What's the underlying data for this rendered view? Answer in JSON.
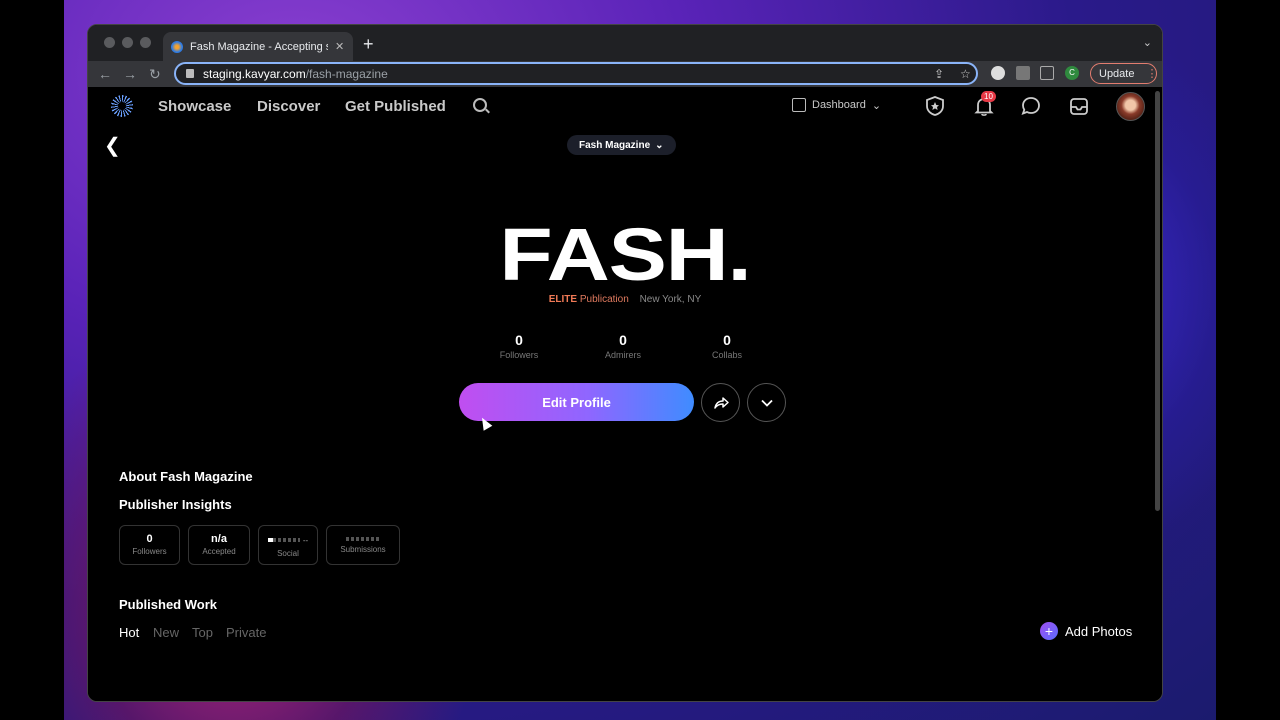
{
  "browser": {
    "tab_title": "Fash Magazine - Accepting sul",
    "tab_close": "✕",
    "new_tab": "+",
    "url_host": "staging.kavyar.com",
    "url_path": "/fash-magazine",
    "update_label": "Update",
    "ext_letter": "C"
  },
  "nav": {
    "links": [
      "Showcase",
      "Discover",
      "Get Published"
    ],
    "dashboard_label": "Dashboard",
    "notification_count": "10"
  },
  "profile": {
    "selector_label": "Fash Magazine",
    "brand": "FASH.",
    "tier": "ELITE",
    "type": "Publication",
    "location": "New York, NY",
    "stats": [
      {
        "value": "0",
        "label": "Followers"
      },
      {
        "value": "0",
        "label": "Admirers"
      },
      {
        "value": "0",
        "label": "Collabs"
      }
    ],
    "edit_label": "Edit Profile"
  },
  "about": {
    "title": "About Fash Magazine",
    "insights_title": "Publisher Insights",
    "insights": [
      {
        "value": "0",
        "label": "Followers"
      },
      {
        "value": "n/a",
        "label": "Accepted"
      },
      {
        "value": "--",
        "label": "Social"
      },
      {
        "value": "",
        "label": "Submissions"
      }
    ]
  },
  "work": {
    "title": "Published Work",
    "filters": [
      "Hot",
      "New",
      "Top",
      "Private"
    ],
    "active_filter": "Hot",
    "add_photos_label": "Add Photos"
  },
  "colors": {
    "accent_start": "#c04ef0",
    "accent_end": "#3f8cff",
    "elite": "#f07a56",
    "badge": "#e63946"
  }
}
